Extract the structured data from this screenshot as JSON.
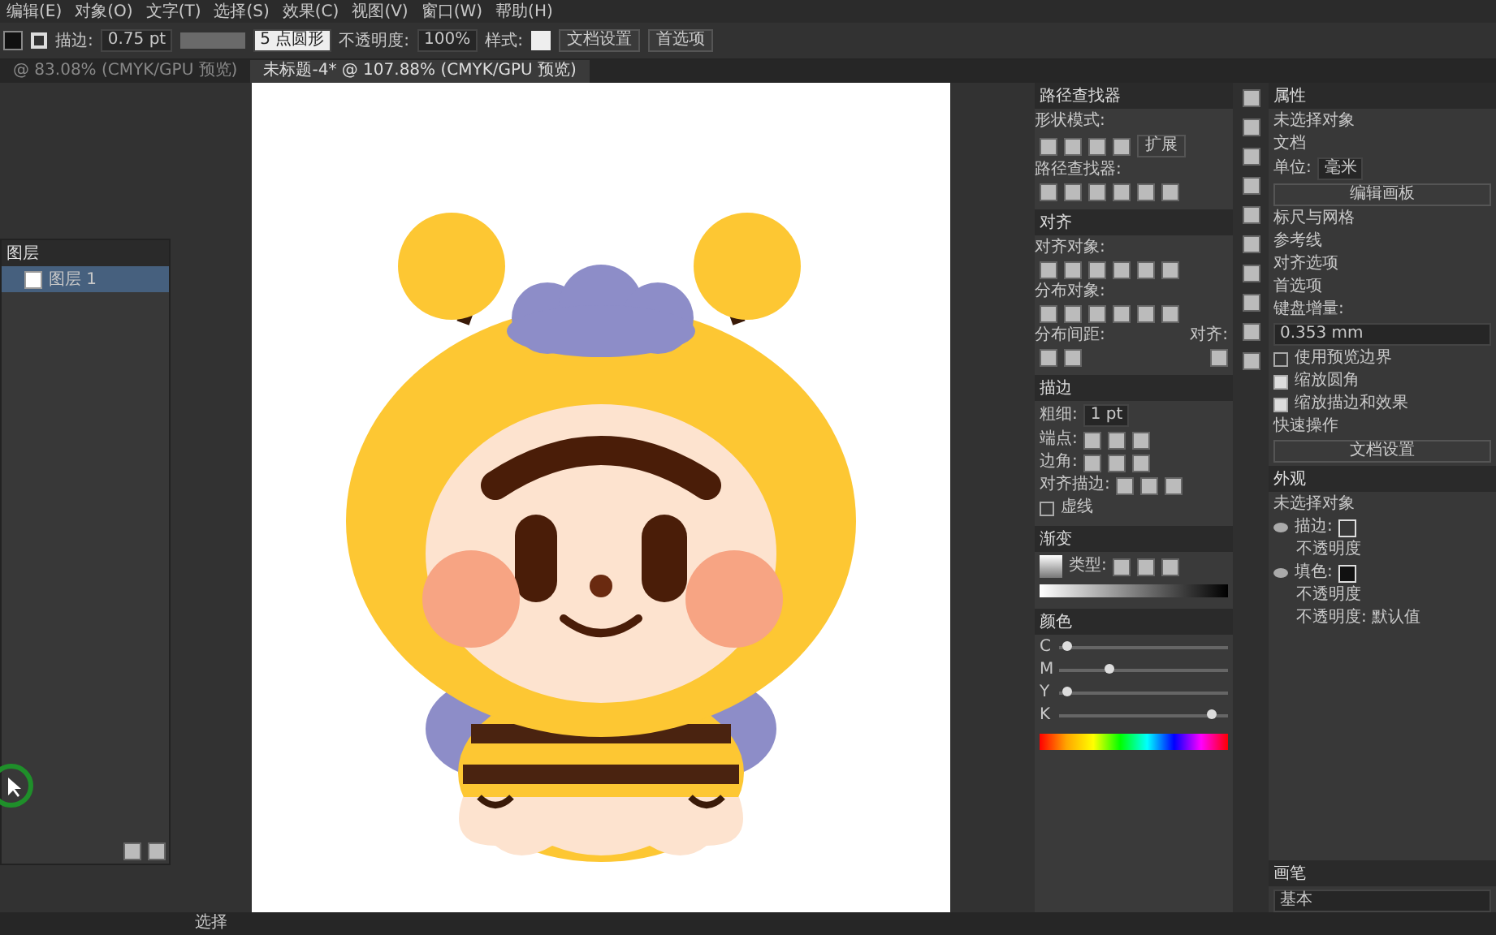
{
  "menu": [
    "编辑(E)",
    "对象(O)",
    "文字(T)",
    "选择(S)",
    "效果(C)",
    "视图(V)",
    "窗口(W)",
    "帮助(H)"
  ],
  "control_bar": {
    "stroke_label": "描边:",
    "stroke_value": "0.75 pt",
    "brush": "5 点圆形",
    "opacity_label": "不透明度:",
    "opacity_value": "100%",
    "style_label": "样式:",
    "buttons": [
      "文档设置",
      "首选项"
    ]
  },
  "doc_tabs": [
    {
      "title": "@ 83.08% (CMYK/GPU 预览)",
      "selected": false
    },
    {
      "title": "未标题-4* @ 107.88% (CMYK/GPU 预览)",
      "selected": true
    }
  ],
  "layers_panel": {
    "title": "图层",
    "layers": [
      {
        "name": "图层 1",
        "selected": true
      }
    ]
  },
  "pathfinder": {
    "title": "路径查找器",
    "shape_modes_label": "形状模式:",
    "expand_button": "扩展",
    "pathfinders_label": "路径查找器:"
  },
  "align": {
    "title": "对齐",
    "align_objects_label": "对齐对象:",
    "distribute_objects_label": "分布对象:",
    "distribute_spacing_label": "分布间距:",
    "align_to_label": "对齐:"
  },
  "stroke": {
    "title": "描边",
    "weight_label": "粗细:",
    "weight_value": "1 pt",
    "cap_label": "端点:",
    "corner_label": "边角:",
    "align_stroke_label": "对齐描边:",
    "dashed_label": "虚线",
    "dashed": false
  },
  "gradient": {
    "title": "渐变",
    "type_label": "类型:"
  },
  "color": {
    "title": "颜色",
    "channels": [
      {
        "name": "C",
        "level": 0.05
      },
      {
        "name": "M",
        "level": 0.3
      },
      {
        "name": "Y",
        "level": 0.05
      },
      {
        "name": "K",
        "level": 0.9
      }
    ]
  },
  "properties": {
    "title": "属性",
    "no_selection": "未选择对象",
    "document_label": "文档",
    "units_label": "单位:",
    "units_value": "毫米",
    "edit_artboards_button": "编辑画板",
    "rulers_label": "标尺与网格",
    "guides_label": "参考线",
    "snap_label": "对齐选项",
    "preferences_label": "首选项",
    "keyboard_increment_label": "键盘增量:",
    "keyboard_increment_value": "0.353 mm",
    "options": [
      {
        "label": "使用预览边界",
        "checked": false
      },
      {
        "label": "缩放圆角",
        "checked": true
      },
      {
        "label": "缩放描边和效果",
        "checked": true
      }
    ],
    "quick_actions_label": "快速操作",
    "document_setup_button": "文档设置"
  },
  "appearance": {
    "title": "外观",
    "header": "未选择对象",
    "rows": [
      {
        "kind": "stroke",
        "label": "描边:"
      },
      {
        "kind": "opacity",
        "label": "不透明度"
      },
      {
        "kind": "fill",
        "label": "填色:"
      },
      {
        "kind": "opacity",
        "label": "不透明度"
      },
      {
        "kind": "opacity",
        "label": "不透明度: 默认值"
      }
    ]
  },
  "brushes": {
    "title": "画笔",
    "preset": "基本"
  },
  "status_bar": {
    "tool": "选择"
  }
}
